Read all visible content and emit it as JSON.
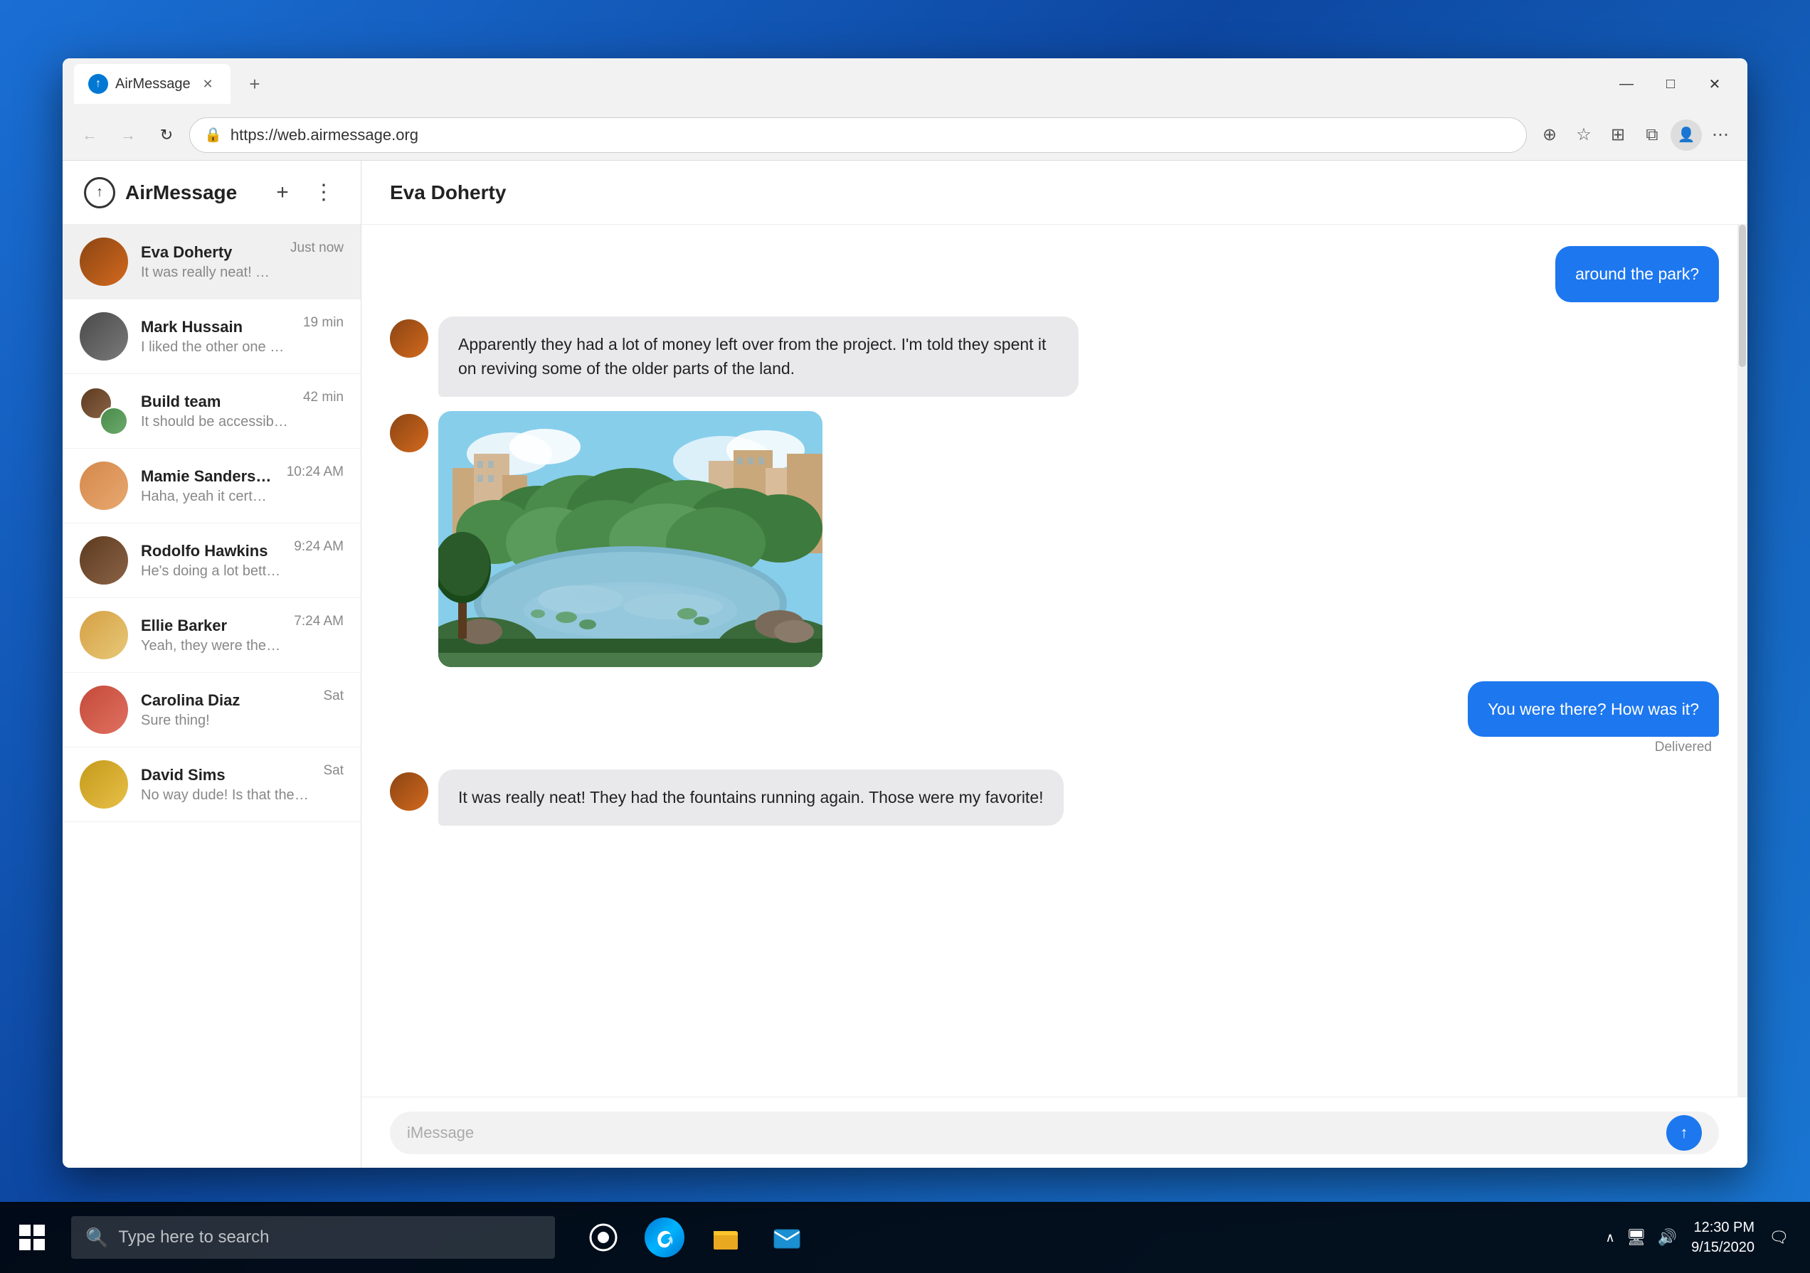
{
  "browser": {
    "tab_title": "AirMessage",
    "url": "https://web.airmessage.org",
    "tab_favicon": "↑"
  },
  "sidebar": {
    "title": "AirMessage",
    "new_btn": "+",
    "more_btn": "⋮",
    "conversations": [
      {
        "id": "eva-doherty",
        "name": "Eva Doherty",
        "preview": "It was really neat! The...",
        "time": "Just now",
        "avatar_type": "ed",
        "active": true
      },
      {
        "id": "mark-hussain",
        "name": "Mark Hussain",
        "preview": "I liked the other one m...",
        "time": "19 min",
        "avatar_type": "mh",
        "active": false
      },
      {
        "id": "build-team",
        "name": "Build team",
        "preview": "It should be accessible, ...",
        "time": "42 min",
        "avatar_type": "group",
        "active": false
      },
      {
        "id": "mamie-sanders",
        "name": "Mamie Sanders a...",
        "preview": "Haha, yeah it certainl...",
        "time": "10:24 AM",
        "avatar_type": "ms",
        "active": false
      },
      {
        "id": "rodolfo-hawkins",
        "name": "Rodolfo Hawkins",
        "preview": "He's doing a lot better...",
        "time": "9:24 AM",
        "avatar_type": "rh",
        "active": false
      },
      {
        "id": "ellie-barker",
        "name": "Ellie Barker",
        "preview": "Yeah, they were the o...",
        "time": "7:24 AM",
        "avatar_type": "eb",
        "active": false
      },
      {
        "id": "carolina-diaz",
        "name": "Carolina Diaz",
        "preview": "Sure thing!",
        "time": "Sat",
        "avatar_type": "cd",
        "active": false
      },
      {
        "id": "david-sims",
        "name": "David Sims",
        "preview": "No way dude! Is that the o...",
        "time": "Sat",
        "avatar_type": "ds",
        "active": false
      }
    ]
  },
  "chat": {
    "contact_name": "Eva Doherty",
    "messages": [
      {
        "id": "msg1",
        "type": "sent",
        "text": "around the park?"
      },
      {
        "id": "msg2",
        "type": "received",
        "text": "Apparently they had a lot of money left over from the project. I'm told they spent it on reviving some of the older parts of the land."
      },
      {
        "id": "msg3",
        "type": "received",
        "is_image": true
      },
      {
        "id": "msg4",
        "type": "sent",
        "text": "You were there? How was it?"
      },
      {
        "id": "msg5",
        "type": "received",
        "text": "It was really neat! They had the fountains running again. Those were my favorite!"
      }
    ],
    "delivered_label": "Delivered",
    "input_placeholder": "iMessage",
    "send_icon": "↑"
  },
  "taskbar": {
    "search_placeholder": "Type here to search",
    "time": "12:30 PM",
    "date": "9/15/2020"
  }
}
